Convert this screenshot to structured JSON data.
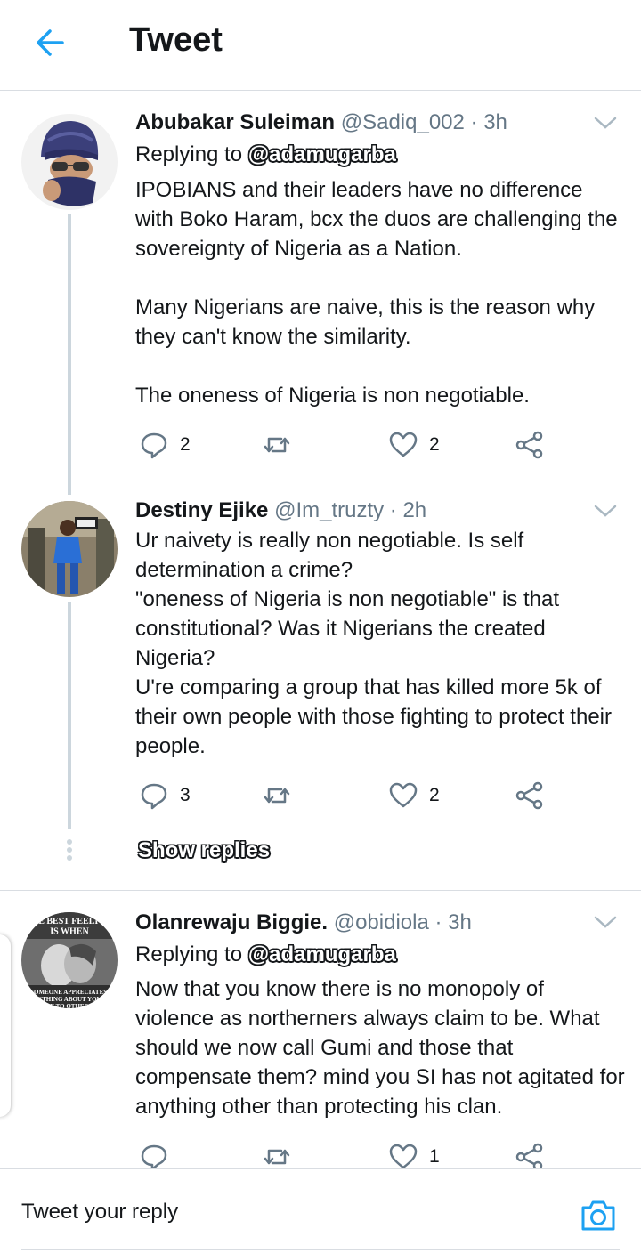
{
  "header": {
    "title": "Tweet",
    "back_icon": "arrow-left-icon",
    "accent": "#1da1f2"
  },
  "tweets": [
    {
      "display_name": "Abubakar Suleiman",
      "handle": "@Sadiq_002",
      "time": "· 3h",
      "reply_prefix": "Replying to",
      "reply_to": "@adamugarba",
      "text": "IPOBIANS and their leaders have no difference with Boko Haram, bcx the duos are challenging the sovereignty of Nigeria as a Nation.\n\nMany Nigerians are naive, this is the reason why they can't know the similarity.\n\nThe oneness of Nigeria is non negotiable.",
      "reply_count": "2",
      "like_count": "2"
    },
    {
      "display_name": "Destiny Ejike",
      "handle": "@Im_truzty",
      "time": "· 2h",
      "text": "Ur naivety is really non negotiable. Is self determination a crime?\n\"oneness of Nigeria is non negotiable\" is that constitutional? Was it Nigerians the created Nigeria?\nU're comparing a group that has killed more 5k of their own people with those fighting to protect their people.",
      "reply_count": "3",
      "like_count": "2"
    },
    {
      "display_name": "Olanrewaju Biggie.",
      "handle": "@obidiola",
      "time": "· 3h",
      "reply_prefix": "Replying to",
      "reply_to": "@adamugarba",
      "avatar_text_top": "E BEST FEELI\nIS WHEN",
      "avatar_text_bottom": "SOMEONE APPRECIATES\nETHING ABOUT YOU\nSE TO OTHERS",
      "text": "Now that you know there is no monopoly of violence as northerners always claim to be. What should we now call Gumi and those that compensate them? mind you SI has not agitated for anything other than protecting his clan.",
      "reply_count": "",
      "like_count": "1"
    }
  ],
  "show_replies": "Show replies",
  "composer": {
    "placeholder": "Tweet your reply",
    "camera_icon": "camera-icon"
  },
  "icons": [
    "reply-icon",
    "retweet-icon",
    "like-icon",
    "share-icon",
    "chevron-down-icon"
  ]
}
